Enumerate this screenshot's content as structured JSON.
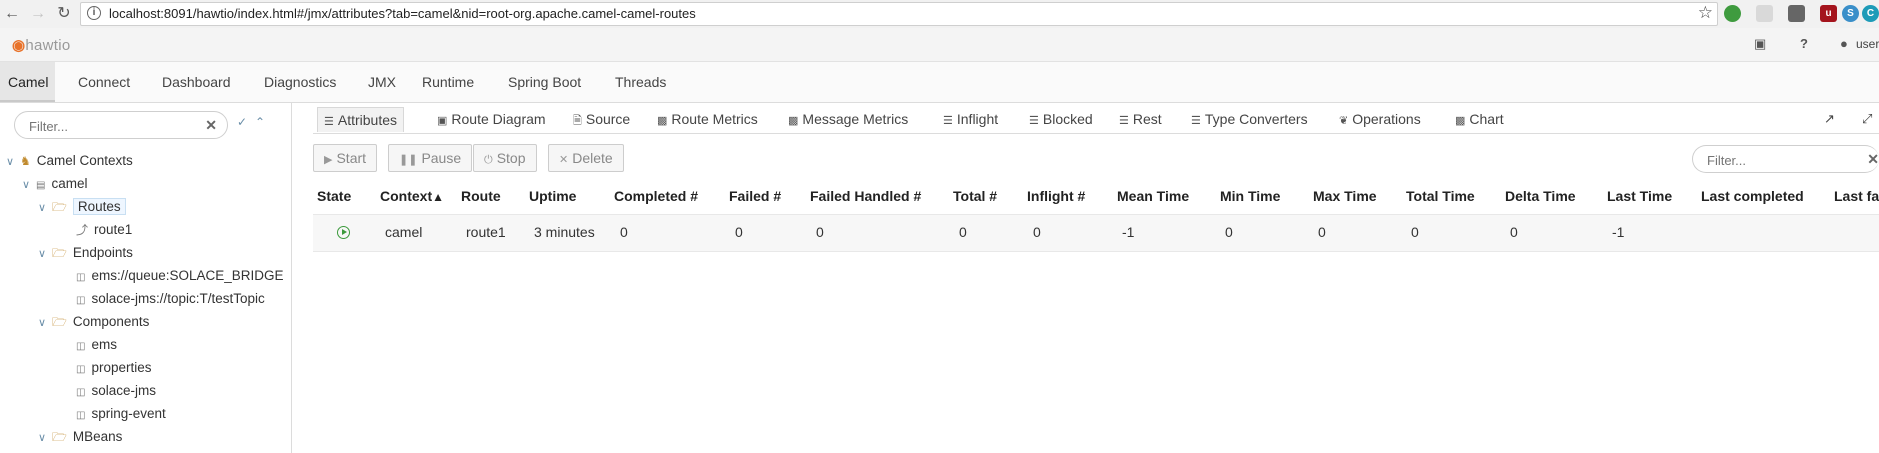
{
  "browser": {
    "back_icon": "arrow-left-icon",
    "forward_icon": "arrow-right-icon",
    "reload_icon": "reload-icon",
    "url": "localhost:8091/hawtio/index.html#/jmx/attributes?tab=camel&nid=root-org.apache.camel-camel-routes"
  },
  "header": {
    "logo_text": "hawtio",
    "user_label": "user"
  },
  "main_nav": {
    "tabs": [
      "Camel",
      "Connect",
      "Dashboard",
      "Diagnostics",
      "JMX",
      "Runtime",
      "Spring Boot",
      "Threads"
    ],
    "active": "Camel"
  },
  "sidebar": {
    "filter_placeholder": "Filter...",
    "tree": {
      "root": "Camel Contexts",
      "context": "camel",
      "routes": "Routes",
      "route1": "route1",
      "endpoints": "Endpoints",
      "endpoint1": "ems://queue:SOLACE_BRIDGE",
      "endpoint2": "solace-jms://topic:T/testTopic",
      "components": "Components",
      "comp1": "ems",
      "comp2": "properties",
      "comp3": "solace-jms",
      "comp4": "spring-event",
      "mbeans": "MBeans"
    }
  },
  "sub_tabs": {
    "items": [
      "Attributes",
      "Route Diagram",
      "Source",
      "Route Metrics",
      "Message Metrics",
      "Inflight",
      "Blocked",
      "Rest",
      "Type Converters",
      "Operations",
      "Chart"
    ],
    "active": "Attributes"
  },
  "toolbar": {
    "start": "Start",
    "pause": "Pause",
    "stop": "Stop",
    "delete": "Delete",
    "filter_placeholder": "Filter..."
  },
  "table": {
    "columns": [
      "State",
      "Context",
      "Route",
      "Uptime",
      "Completed #",
      "Failed #",
      "Failed Handled #",
      "Total #",
      "Inflight #",
      "Mean Time",
      "Min Time",
      "Max Time",
      "Total Time",
      "Delta Time",
      "Last Time",
      "Last completed",
      "Last fa"
    ],
    "sorted_column": "Context",
    "rows": [
      {
        "state": "started",
        "context": "camel",
        "route": "route1",
        "uptime": "3 minutes",
        "completed": "0",
        "failed": "0",
        "failed_handled": "0",
        "total": "0",
        "inflight": "0",
        "mean_time": "-1",
        "min_time": "0",
        "max_time": "0",
        "total_time": "0",
        "delta_time": "0",
        "last_time": "-1"
      }
    ]
  }
}
